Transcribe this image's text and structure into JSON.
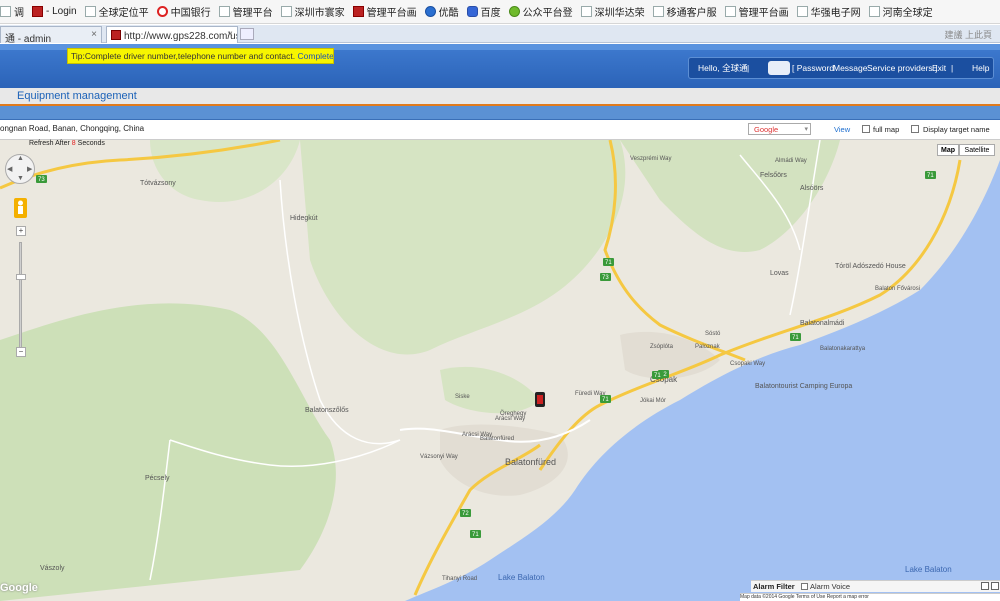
{
  "bookmarks": [
    {
      "label": "调",
      "icon": "blank-page-icon"
    },
    {
      "label": "- Login",
      "icon": "red-square-icon"
    },
    {
      "label": "全球定位平",
      "icon": "blank-page-icon"
    },
    {
      "label": "中国银行",
      "icon": "ring-icon"
    },
    {
      "label": "管理平台",
      "icon": "blank-page-icon"
    },
    {
      "label": "深圳市寰家",
      "icon": "blank-page-icon"
    },
    {
      "label": "管理平台画",
      "icon": "red-square-icon"
    },
    {
      "label": "优酷",
      "icon": "play-circle-icon"
    },
    {
      "label": "百度",
      "icon": "paw-icon"
    },
    {
      "label": "公众平台登",
      "icon": "wechat-icon"
    },
    {
      "label": "深圳华达荣",
      "icon": "blank-page-icon"
    },
    {
      "label": "移通客户服",
      "icon": "blank-page-icon"
    },
    {
      "label": "管理平台画",
      "icon": "blank-page-icon"
    },
    {
      "label": "华强电子网",
      "icon": "blank-page-icon"
    },
    {
      "label": "河南全球定",
      "icon": "blank-page-icon"
    }
  ],
  "tabs": [
    {
      "label": "通 - admin",
      "close": "×"
    },
    {
      "label": "http://www.gps228.com/us...",
      "close": "×"
    }
  ],
  "tabs_right": "建議 上此頁",
  "tip": {
    "text": "Tip:Complete driver number,telephone number and contact.",
    "complete": "Complete",
    "sep": "|",
    "close": "close"
  },
  "user": {
    "hello": "Hello, 全球通",
    "pipe1": "|",
    "password": "[ Password",
    "message": "Message",
    "service": "Service providers ]",
    "exit": "Exit",
    "pipe2": "|",
    "help": "Help"
  },
  "page_title": "Equipment management",
  "address": "ongnan Road, Banan, Chongqing, China",
  "map_provider": "Google",
  "view_label": "View",
  "full_map_label": "full map",
  "display_target_label": "Display target name",
  "refresh": {
    "before": "Refresh After ",
    "count": "8",
    "after": " Seconds"
  },
  "map_types": {
    "map": "Map",
    "satellite": "Satellite"
  },
  "map_labels": [
    {
      "t": "Tótvázsony"
    },
    {
      "t": "Hidegkút"
    },
    {
      "t": "Felsőörs"
    },
    {
      "t": "Alsóörs"
    },
    {
      "t": "Lovas"
    },
    {
      "t": "Tóröl Adószedó House"
    },
    {
      "t": "Balatonalmádi"
    },
    {
      "t": "Csopak"
    },
    {
      "t": "Balatontourist Camping Europa"
    },
    {
      "t": "Balatonfüred"
    },
    {
      "t": "Balatonszőlős"
    },
    {
      "t": "Pécsely"
    },
    {
      "t": "Vászoly"
    },
    {
      "t": "Lake Balaton"
    },
    {
      "t": "Lake Balaton"
    },
    {
      "t": "Arácsi Way"
    },
    {
      "t": "Füredi Way"
    },
    {
      "t": "Siske"
    },
    {
      "t": "Öreghegy"
    },
    {
      "t": "Zsóplóta"
    },
    {
      "t": "Paloznak"
    },
    {
      "t": "Csopaki Way"
    },
    {
      "t": "Almádi Way"
    },
    {
      "t": "Veszprémi Way"
    },
    {
      "t": "Arácsi Way"
    },
    {
      "t": "Vázsonyi Way"
    },
    {
      "t": "Jókai Mór"
    },
    {
      "t": "Tihanyi Road"
    },
    {
      "t": "Balatonfüred"
    },
    {
      "t": "Balaton Fővárosi"
    },
    {
      "t": "Sóstó"
    },
    {
      "t": "Balatonakarattya"
    }
  ],
  "road_shields": [
    "73",
    "73",
    "72",
    "72",
    "71",
    "71",
    "71",
    "71",
    "71",
    "71"
  ],
  "alarm": {
    "filter": "Alarm Filter",
    "voice": "Alarm Voice"
  },
  "copyright": "Map data ©2014 Google  Terms of Use  Report a map error",
  "google_logo": "Google",
  "colors": {
    "header": "#2f6cc2",
    "tip_bg": "#f7f500",
    "water": "#9ebdf0",
    "land": "#eae7e0",
    "accent_orange": "#e07a1c",
    "link_blue": "#1c62b8"
  }
}
